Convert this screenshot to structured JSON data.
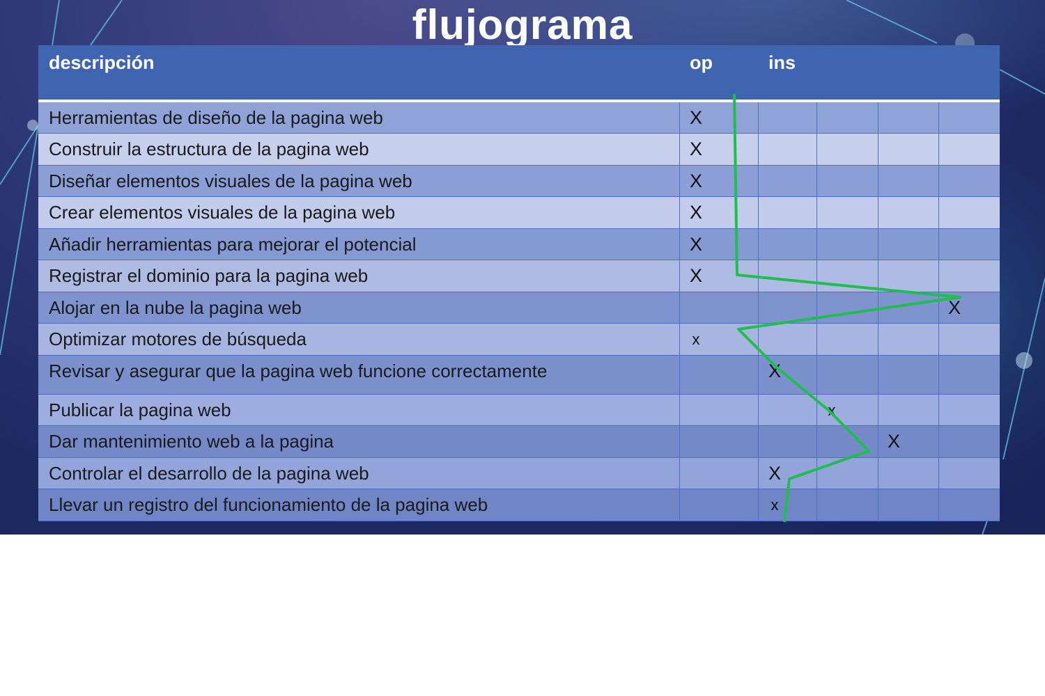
{
  "title": "flujograma",
  "headers": {
    "descripcion": "descripción",
    "op": "op",
    "ins": "ins"
  },
  "colors": {
    "header": "#3f64b0",
    "row_dark": "#8a9fd6",
    "row_light": "#c4cdeb",
    "line": "#1fbf4f"
  },
  "rows": [
    {
      "label": "Herramientas de diseño de la pagina web",
      "mark": "X",
      "col": 0
    },
    {
      "label": "Construir la estructura de la pagina web",
      "mark": "X",
      "col": 0
    },
    {
      "label": "Diseñar elementos visuales de la pagina web",
      "mark": "X",
      "col": 0
    },
    {
      "label": "Crear elementos visuales de la pagina web",
      "mark": "X",
      "col": 0
    },
    {
      "label": "Añadir herramientas para mejorar el potencial",
      "mark": "X",
      "col": 0
    },
    {
      "label": "Registrar el dominio para la pagina web",
      "mark": "X",
      "col": 0
    },
    {
      "label": "Alojar en la nube la pagina web",
      "mark": "X",
      "col": 5
    },
    {
      "label": "Optimizar motores de búsqueda",
      "mark": "x",
      "col": 0
    },
    {
      "label": "Revisar y asegurar que la pagina web funcione correctamente",
      "mark": "X",
      "col": 1
    },
    {
      "label": "Publicar la pagina web",
      "mark": "x",
      "col": 2
    },
    {
      "label": "Dar mantenimiento web a la pagina",
      "mark": "X",
      "col": 3
    },
    {
      "label": "Controlar el desarrollo de la pagina web",
      "mark": "X",
      "col": 1
    },
    {
      "label": "Llevar un registro del funcionamiento de la pagina web",
      "mark": "x",
      "col": 1
    }
  ]
}
